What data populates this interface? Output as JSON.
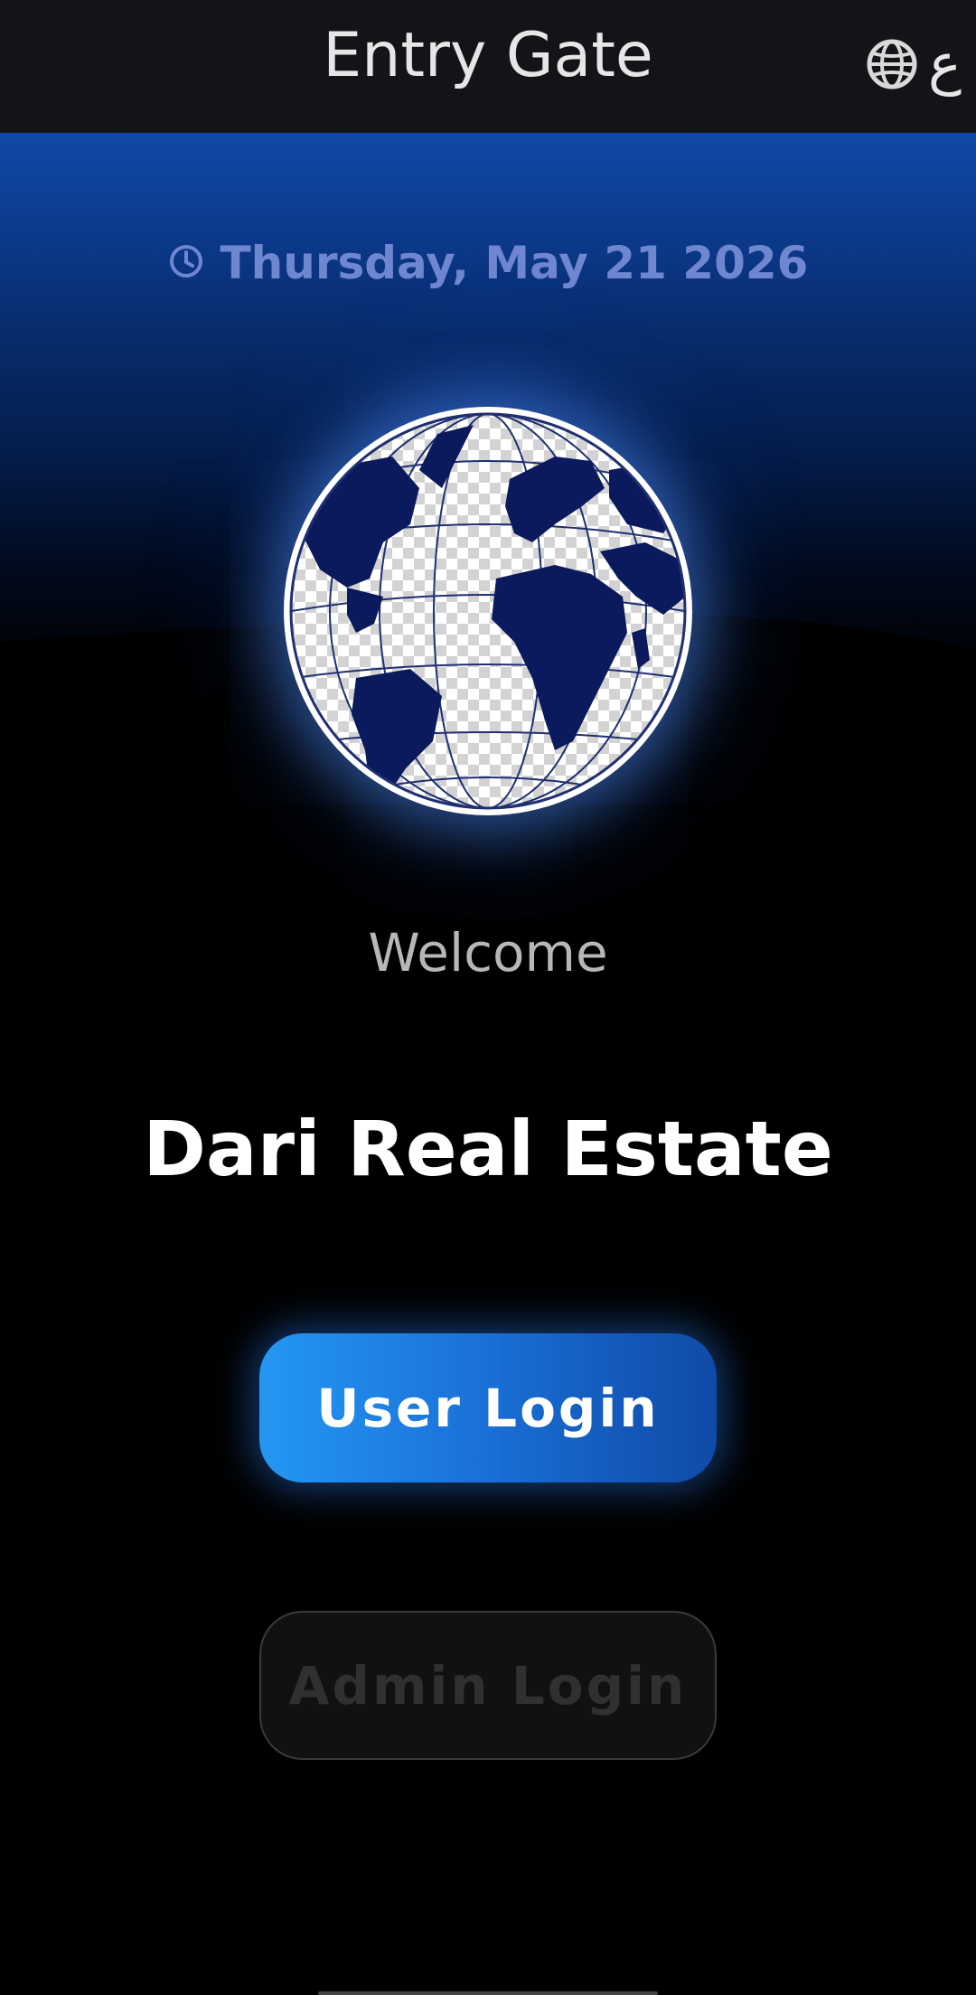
{
  "appbar": {
    "title": "Entry Gate",
    "language_icon": "globe-icon",
    "language_code": "ع"
  },
  "hero": {
    "date_icon": "clock-icon",
    "date": "Thursday, May 21 2026",
    "logo": "globe-logo"
  },
  "main": {
    "welcome": "Welcome",
    "brand_name": "Dari Real Estate",
    "user_login_label": "User Login",
    "admin_login_label": "Admin Login"
  },
  "colors": {
    "appbar_bg": "#131417",
    "hero_top": "#1149a8",
    "date_text": "#6f86d0",
    "primary_button": "#1a6fd6",
    "globe_land": "#0a1a5c"
  }
}
